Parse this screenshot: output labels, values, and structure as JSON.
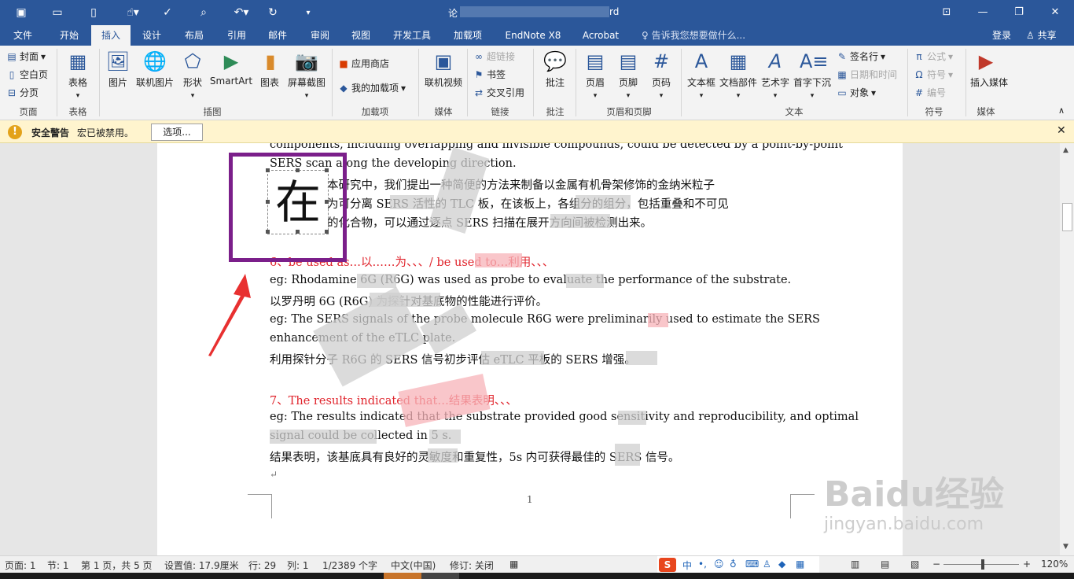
{
  "titlebar": {
    "title_visible_prefix": "论",
    "title_visible_suffix": "rd",
    "icons": [
      "save-icon",
      "open-icon",
      "new-icon",
      "touch-mode-icon",
      "spelling-icon",
      "print-preview-icon",
      "undo-icon",
      "redo-icon",
      "customize-icon"
    ]
  },
  "tabs": [
    "文件",
    "开始",
    "插入",
    "设计",
    "布局",
    "引用",
    "邮件",
    "审阅",
    "视图",
    "开发工具",
    "加载项",
    "EndNote X8",
    "Acrobat"
  ],
  "active_tab": "插入",
  "tell_me": "告诉我您想要做什么...",
  "login": "登录",
  "share": "共享",
  "ribbon": {
    "pages": {
      "cover": "封面",
      "blank": "空白页",
      "break": "分页",
      "group": "页面"
    },
    "tables": {
      "table": "表格",
      "group": "表格"
    },
    "illustrations": {
      "picture": "图片",
      "online_picture": "联机图片",
      "shapes": "形状",
      "smartart": "SmartArt",
      "chart": "图表",
      "screenshot": "屏幕截图",
      "group": "插图"
    },
    "addins": {
      "store": "应用商店",
      "my_addins": "我的加载项",
      "group": "加载项"
    },
    "media": {
      "online_video": "联机视频",
      "group": "媒体"
    },
    "links": {
      "hyperlink": "超链接",
      "bookmark": "书签",
      "cross_ref": "交叉引用",
      "group": "链接"
    },
    "comments": {
      "comment": "批注",
      "group": "批注"
    },
    "header_footer": {
      "header": "页眉",
      "footer": "页脚",
      "page_number": "页码",
      "group": "页眉和页脚"
    },
    "text": {
      "textbox": "文本框",
      "quick_parts": "文档部件",
      "wordart": "艺术字",
      "dropcap": "首字下沉",
      "signature": "签名行",
      "datetime": "日期和时间",
      "object": "对象",
      "group": "文本"
    },
    "symbols": {
      "equation": "公式",
      "symbol": "符号",
      "number": "编号",
      "group": "符号"
    },
    "embed": {
      "insert_media": "插入媒体",
      "group": "媒体"
    }
  },
  "security": {
    "title": "安全警告",
    "message": "宏已被禁用。",
    "button": "选项..."
  },
  "document": {
    "dropcap_char": "在",
    "lines": [
      "components, including overlapping and invisible compounds, could be detected by a point-by-point",
      "SERS scan along the developing direction.",
      "本研究中，我们提出一种简便的方法来制备以金属有机骨架修饰的金纳米粒子",
      "为可分离 SERS 活性的 TLC 板，在该板上，各组分的组分，包括重叠和不可见",
      "的化合物，可以通过逐点 SERS 扫描在展开方向间被检测出来。",
      "6、be used as…以……为、、、/ be used to…利用、、、",
      "eg: Rhodamine 6G (R6G) was used as probe to evaluate the performance of the substrate.",
      "以罗丹明 6G (R6G) 为探针对基底物的性能进行评价。",
      "eg: The SERS signals of the probe molecule R6G were preliminarily used to estimate the SERS",
      "enhancement of the eTLC plate.",
      "利用探针分子 R6G 的 SERS 信号初步评估 eTLC 平板的 SERS 增强。",
      "7、The results indicated that…结果表明、、、",
      "eg: The results indicated that the substrate provided good sensitivity and reproducibility, and optimal",
      "signal could be collected in 5 s.",
      "结果表明，该基底具有良好的灵敏度和重复性，5s 内可获得最佳的 SERS 信号。"
    ],
    "page_number": "1"
  },
  "status": {
    "page": "页面: 1",
    "section": "节: 1",
    "page_of": "第 1 页，共 5 页",
    "setting": "设置值: 17.9厘米",
    "row": "行: 29",
    "col": "列: 1",
    "words": "1/2389 个字",
    "lang": "中文(中国)",
    "track": "修订: 关闭",
    "zoom": "120%"
  },
  "watermark": {
    "brand": "Baidu经验",
    "url": "jingyan.baidu.com"
  },
  "colors": {
    "accent": "#2b579a",
    "annotation": "#7b1f8a",
    "arrow": "#e83030",
    "red_text": "#e0242c"
  }
}
